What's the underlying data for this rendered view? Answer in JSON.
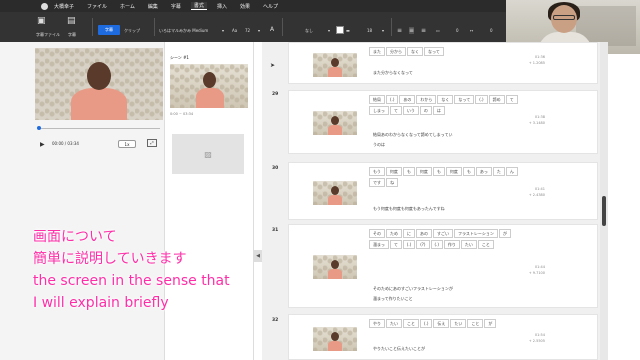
{
  "user": {
    "name": "大橋幸子"
  },
  "menu": {
    "items": [
      "ファイル",
      "ホーム",
      "編集",
      "字幕",
      "書式",
      "挿入",
      "効果",
      "ヘルプ"
    ],
    "active_index": 4
  },
  "toolbar": {
    "left_labels": [
      "字幕ファイル",
      "字幕"
    ],
    "primary_button": "字幕",
    "clip_button": "クリップ",
    "font_name": "いろはマルみかみ Medium",
    "font_size": "72",
    "line_spacing": "なし",
    "outline_size": "18",
    "position_value": "0",
    "letter_value": "0"
  },
  "webcam": {
    "name_tag": "大橋幸子"
  },
  "player": {
    "time": "00:00 / 03:34",
    "speed": "1x"
  },
  "scenes": {
    "label": "シーン #1",
    "time": "0:00 ~ 03:34"
  },
  "rows": [
    {
      "num": "",
      "words": [
        "また",
        "分から",
        "なく",
        "なって"
      ],
      "full_text": [
        "また分からなくなって"
      ],
      "start": "01:36",
      "dur": "+ 1.2085"
    },
    {
      "num": "29",
      "words": [
        "結局",
        "(.)",
        "あの",
        "わから",
        "なく",
        "なって",
        "(.)",
        "諦め",
        "て",
        "しまっ",
        "て",
        "いう",
        "の",
        "は"
      ],
      "full_text": [
        "結局あのわからなくなって諦めてしまってい",
        "うのは"
      ],
      "start": "01:38",
      "dur": "+ 3.1480"
    },
    {
      "num": "30",
      "words": [
        "もう",
        "何度",
        "も",
        "何度",
        "も",
        "何度",
        "も",
        "あっ",
        "た",
        "ん",
        "です",
        "ね"
      ],
      "full_text": [
        "もう何度も何度も何度もあったんですね"
      ],
      "start": "01:41",
      "dur": "+ 2.4380"
    },
    {
      "num": "31",
      "words": [
        "その",
        "ため",
        "に",
        "あの",
        "すごい",
        "フラストレーション",
        "が",
        "溜まっ",
        "て",
        "(.)",
        "(?)",
        "(.)",
        "作り",
        "たい",
        "こと"
      ],
      "full_text": [
        "そのためにあのすごいフラストレーションが",
        "溜まって作りたいこと"
      ],
      "start": "01:44",
      "dur": "+ 9.7100"
    },
    {
      "num": "32",
      "words": [
        "やり",
        "たい",
        "こと",
        "(.)",
        "伝え",
        "たい",
        "こと",
        "が"
      ],
      "full_text": [
        "やりたいこと伝えたいことが"
      ],
      "start": "01:54",
      "dur": "+ 2.5505"
    }
  ],
  "caption": {
    "line1": "画面について",
    "line2": "簡単に説明していきます",
    "line3": "the screen in the sense that",
    "line4": "I will explain briefly"
  },
  "colors": {
    "accent": "#1e6be0",
    "caption": "#ff2ea8",
    "toolbar_bg": "#333333"
  }
}
